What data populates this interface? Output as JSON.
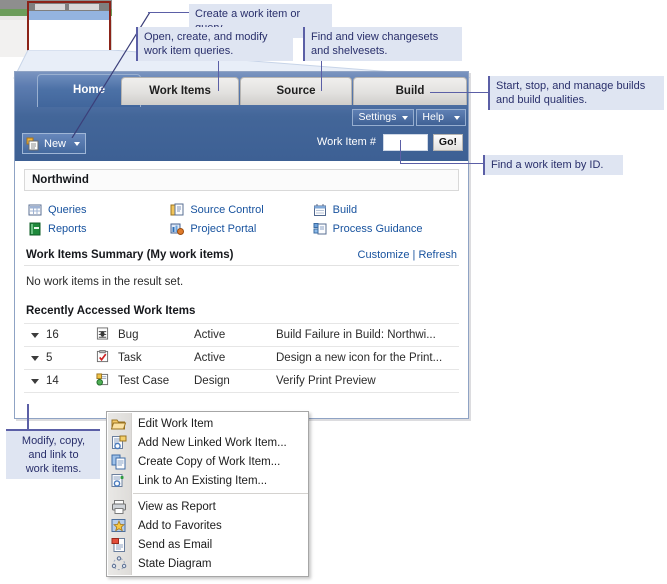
{
  "callouts": [
    {
      "id": "create-work-item",
      "text": "Create a work item or query."
    },
    {
      "id": "work-item-queries",
      "text": "Open, create, and modify\nwork item queries."
    },
    {
      "id": "changesets",
      "text": "Find and view changesets\nand shelvesets."
    },
    {
      "id": "builds",
      "text": "Start, stop, and manage builds\nand build qualities."
    },
    {
      "id": "find-by-id",
      "text": "Find a work item by ID."
    },
    {
      "id": "modify-copy-link",
      "text": "Modify, copy,\nand link to\nwork items."
    }
  ],
  "app": {
    "tabs": [
      {
        "label": "Home",
        "active": true
      },
      {
        "label": "Work Items",
        "active": false
      },
      {
        "label": "Source",
        "active": false
      },
      {
        "label": "Build",
        "active": false
      }
    ],
    "utility": [
      {
        "label": "Settings",
        "icon": "chevron-down-icon"
      },
      {
        "label": "Help",
        "icon": "chevron-down-icon"
      }
    ],
    "commandbar": {
      "new_label": "New",
      "new_icon": "new-document-icon",
      "new_caret": "chevron-down-icon",
      "work_item_label": "Work Item #",
      "work_item_value": "",
      "work_item_placeholder": "",
      "go_label": "Go!"
    },
    "content": {
      "project_name": "Northwind",
      "links": [
        [
          {
            "label": "Queries",
            "icon": "queries-icon"
          },
          {
            "label": "Reports",
            "icon": "reports-icon"
          }
        ],
        [
          {
            "label": "Source Control",
            "icon": "source-control-icon"
          },
          {
            "label": "Project Portal",
            "icon": "project-portal-icon"
          }
        ],
        [
          {
            "label": "Build",
            "icon": "build-icon"
          },
          {
            "label": "Process Guidance",
            "icon": "process-guidance-icon"
          }
        ]
      ],
      "summary": {
        "title": "Work Items Summary (My work items)",
        "customize_label": "Customize",
        "separator": "|",
        "refresh_label": "Refresh",
        "empty_message": "No work items in the result set."
      },
      "recent": {
        "title": "Recently Accessed Work Items",
        "rows": [
          {
            "id": "16",
            "type": "Bug",
            "icon": "bug-icon",
            "state": "Active",
            "title": "Build Failure in Build: Northwi..."
          },
          {
            "id": "5",
            "type": "Task",
            "icon": "task-icon",
            "state": "Active",
            "title": "Design a new icon for the Print..."
          },
          {
            "id": "14",
            "type": "Test Case",
            "icon": "test-case-icon",
            "state": "Design",
            "title": "Verify Print Preview"
          }
        ]
      }
    }
  },
  "context_menu": {
    "groups": [
      [
        {
          "label": "Edit Work Item",
          "icon": "open-folder-icon"
        },
        {
          "label": "Add New Linked Work Item...",
          "icon": "add-linked-item-icon"
        },
        {
          "label": "Create Copy of Work Item...",
          "icon": "copy-icon"
        },
        {
          "label": "Link to An Existing Item...",
          "icon": "link-item-icon"
        }
      ],
      [
        {
          "label": "View as Report",
          "icon": "printer-icon"
        },
        {
          "label": "Add to Favorites",
          "icon": "favorites-star-icon"
        },
        {
          "label": "Send as Email",
          "icon": "email-icon"
        },
        {
          "label": "State Diagram",
          "icon": "state-diagram-icon"
        }
      ]
    ]
  },
  "colors": {
    "callout_bg": "#dfe5f2",
    "callout_text": "#292f6b",
    "leader": "#5b5fa6",
    "chrome_blue": "#436699",
    "link_blue": "#17529e",
    "thumb_highlight": "#8b2318"
  }
}
